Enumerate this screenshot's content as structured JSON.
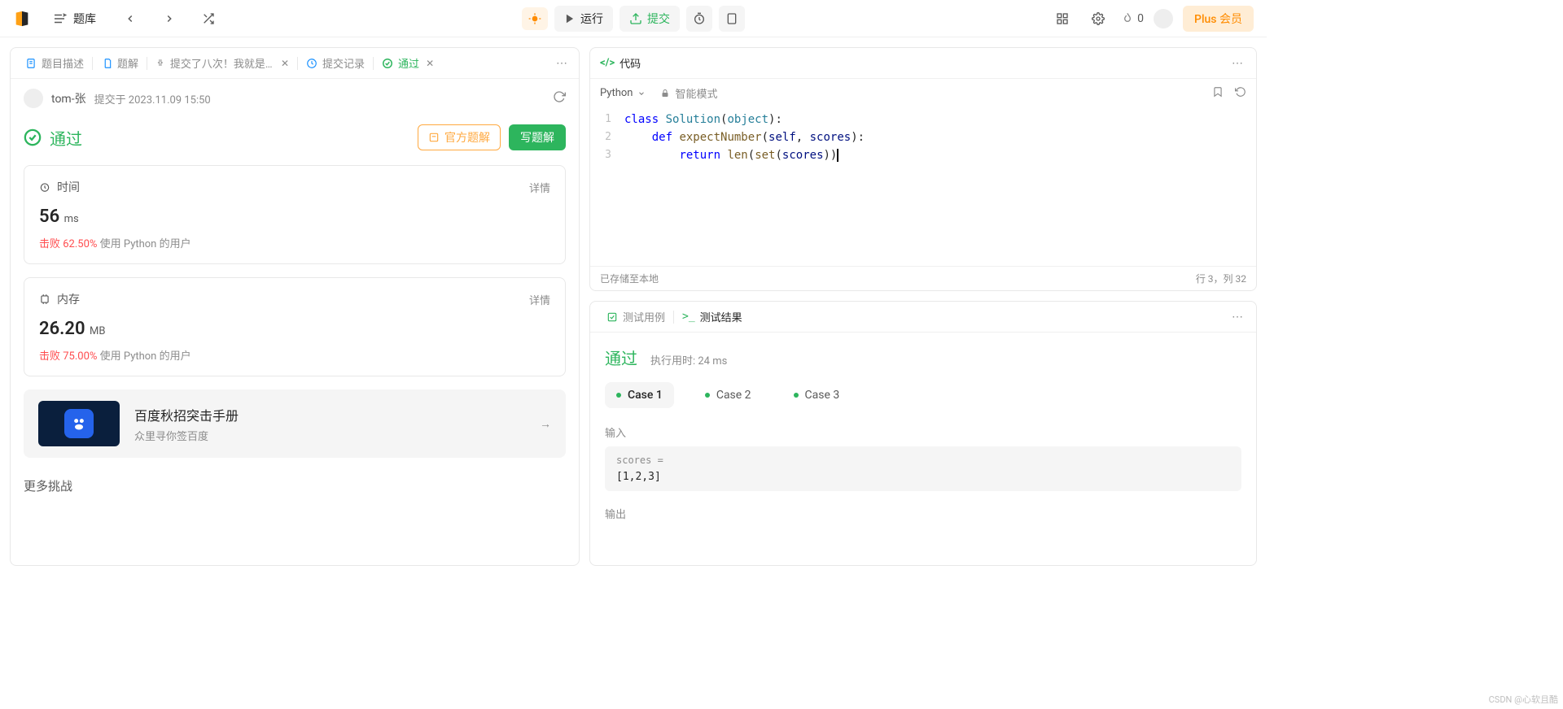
{
  "topbar": {
    "bank_label": "题库",
    "run_label": "运行",
    "submit_label": "提交",
    "streak_count": "0",
    "plus_label": "Plus 会员"
  },
  "left": {
    "tabs": {
      "desc": "题目描述",
      "solution": "题解",
      "submit_many": "提交了八次！我就是个笨…",
      "history": "提交记录",
      "accepted": "通过"
    },
    "user": {
      "name": "tom-张",
      "meta": "提交于 2023.11.09 15:50"
    },
    "accepted_label": "通过",
    "official_solution_btn": "官方题解",
    "write_solution_btn": "写题解",
    "time_card": {
      "title": "时间",
      "detail": "详情",
      "value": "56",
      "unit": "ms",
      "beat_prefix": "击败",
      "beat_pct": "62.50%",
      "beat_suffix": "使用 Python 的用户"
    },
    "mem_card": {
      "title": "内存",
      "detail": "详情",
      "value": "26.20",
      "unit": "MB",
      "beat_prefix": "击败",
      "beat_pct": "75.00%",
      "beat_suffix": "使用 Python 的用户"
    },
    "promo": {
      "title": "百度秋招突击手册",
      "sub": "众里寻你签百度"
    },
    "more_title": "更多挑战"
  },
  "code": {
    "tab_label": "代码",
    "language": "Python",
    "smart_mode": "智能模式",
    "status_left": "已存储至本地",
    "status_right": "行 3，列 32",
    "lines": [
      "1",
      "2",
      "3"
    ]
  },
  "test": {
    "tab_cases": "测试用例",
    "tab_results": "测试结果",
    "pass_label": "通过",
    "runtime": "执行用时: 24 ms",
    "cases": [
      "Case 1",
      "Case 2",
      "Case 3"
    ],
    "input_label": "输入",
    "input_field": "scores =",
    "input_value": "[1,2,3]",
    "output_label": "输出"
  },
  "watermark": "CSDN @心软且酷"
}
